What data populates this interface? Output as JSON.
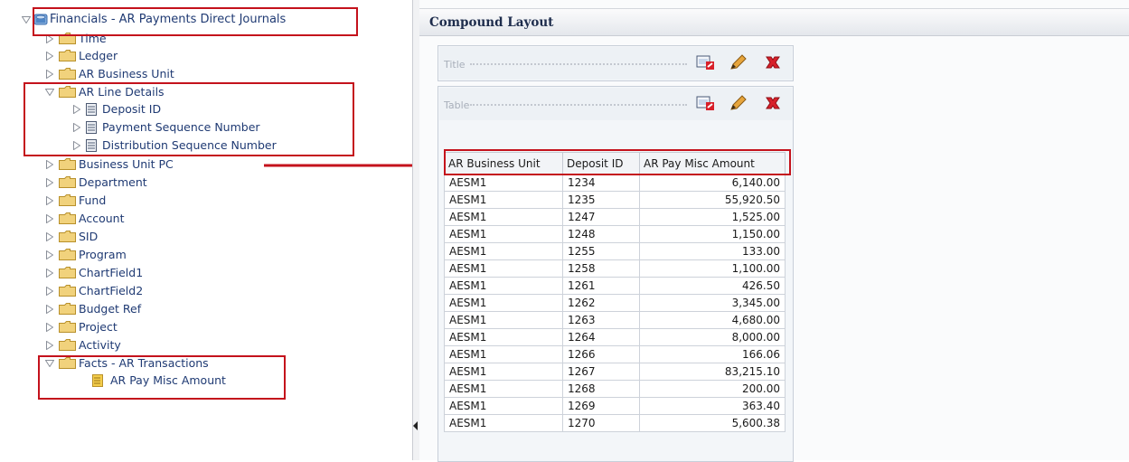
{
  "tree": {
    "root_label": "Financials - AR Payments Direct Journals",
    "folders_top": [
      "Time",
      "Ledger",
      "AR Business Unit"
    ],
    "ar_line_details": {
      "label": "AR Line Details",
      "columns": [
        "Deposit ID",
        "Payment Sequence Number",
        "Distribution Sequence Number"
      ]
    },
    "folders_mid": [
      "Business Unit PC",
      "Department",
      "Fund",
      "Account",
      "SID",
      "Program",
      "ChartField1",
      "ChartField2",
      "Budget Ref",
      "Project",
      "Activity"
    ],
    "facts": {
      "label": "Facts - AR Transactions",
      "measure": "AR Pay Misc Amount"
    }
  },
  "compound_layout": {
    "title": "Compound Layout",
    "views": {
      "title_view": "Title",
      "table_view": "Table"
    }
  },
  "table": {
    "headers": [
      "AR Business Unit",
      "Deposit ID",
      "AR Pay Misc Amount"
    ],
    "rows": [
      [
        "AESM1",
        "1234",
        "6,140.00"
      ],
      [
        "AESM1",
        "1235",
        "55,920.50"
      ],
      [
        "AESM1",
        "1247",
        "1,525.00"
      ],
      [
        "AESM1",
        "1248",
        "1,150.00"
      ],
      [
        "AESM1",
        "1255",
        "133.00"
      ],
      [
        "AESM1",
        "1258",
        "1,100.00"
      ],
      [
        "AESM1",
        "1261",
        "426.50"
      ],
      [
        "AESM1",
        "1262",
        "3,345.00"
      ],
      [
        "AESM1",
        "1263",
        "4,680.00"
      ],
      [
        "AESM1",
        "1264",
        "8,000.00"
      ],
      [
        "AESM1",
        "1266",
        "166.06"
      ],
      [
        "AESM1",
        "1267",
        "83,215.10"
      ],
      [
        "AESM1",
        "1268",
        "200.00"
      ],
      [
        "AESM1",
        "1269",
        "363.40"
      ],
      [
        "AESM1",
        "1270",
        "5,600.38"
      ]
    ]
  },
  "colors": {
    "highlight": "#c4121c",
    "folder": "#e9c46a",
    "tree_text": "#1f3a73"
  }
}
